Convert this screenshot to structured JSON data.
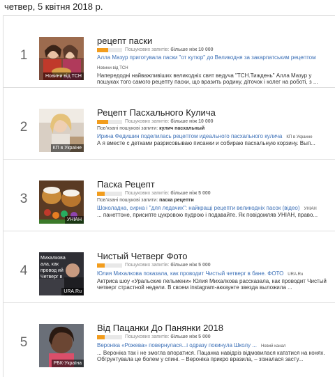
{
  "date_header": "четвер, 5 квітня 2018 р.",
  "volume_label": "Пошукових запитів:",
  "related_label": "Пов'язані пошукові запити:",
  "trends": [
    {
      "rank": "1",
      "title": "рецепт паски",
      "volume": "більше ніж 10 000",
      "volume_fill": 0.45,
      "thumb_source": "Новини від ТСН",
      "headline": "Алла Мазур приготувала паски \"от кутюр\" до Великодня за закарпатським рецептом",
      "headline_source": "Новини від ТСН",
      "snippet": "Напередодні найважливіших великодніх свят ведуча \"ТСН.Тиждень\" Алла Мазур у пошуках того самого рецепту паски, що вразить родину, діточок і колег на роботі, з ..."
    },
    {
      "rank": "2",
      "title": "Рецепт Пасхального Кулича",
      "volume": "більше ніж 10 000",
      "volume_fill": 0.45,
      "thumb_source": "КП в Україне",
      "related": "кулич пасхальный",
      "headline": "Ирина Федишин поделилась рецептом идеального пасхального кулича",
      "headline_source": "КП в Украине",
      "snippet": "А я вместе с детками разрисовываю писанки и собираю пасхальную корзину. Вып..."
    },
    {
      "rank": "3",
      "title": "Паска Рецепт",
      "volume": "більше ніж 5 000",
      "volume_fill": 0.3,
      "thumb_source": "УНІАН",
      "related": "паска рецепти",
      "headline": "Шоколадна, сирна і \"для ледачих\": найкращі рецепти великодніх пасок (відео)",
      "headline_source": "УНІАН",
      "snippet": "... панеттоне, присипте цукровою пудрою і подавайте. Як повідомляв УНІАН, право..."
    },
    {
      "rank": "4",
      "title": "Чистый Четверг Фото",
      "volume": "більше ніж 5 000",
      "volume_fill": 0.3,
      "thumb_source": "URA.Ru",
      "thumb_text": "Михалкова  ала, как провод  ий Четверг в",
      "headline": "Юлия Михалкова показала, как проводит Чистый четверг в бане. ФОТО",
      "headline_source": "URA.Ru",
      "snippet": "Актриса шоу «Уральские пельмени» Юлия Михалкова рассказала, как проводит Чистый четверг страстной недели. В своем instagram-аккаунте звезда выложила ..."
    },
    {
      "rank": "5",
      "title": "Від Пацанки До Панянки 2018",
      "volume": "більше ніж 5 000",
      "volume_fill": 0.3,
      "thumb_source": "РБК-Україна",
      "headline": "Вероніка «Рожева» повернулася...і одразу покинула Школу ...",
      "headline_source": "Новий канал",
      "snippet": "... Вероніка так і не змогла впоратися. Пацанка навідріз відмовилася кататися на конях. Обгрунтувала це болем у спині. – Вероніка прикро вразила, – зізналася засту..."
    }
  ]
}
